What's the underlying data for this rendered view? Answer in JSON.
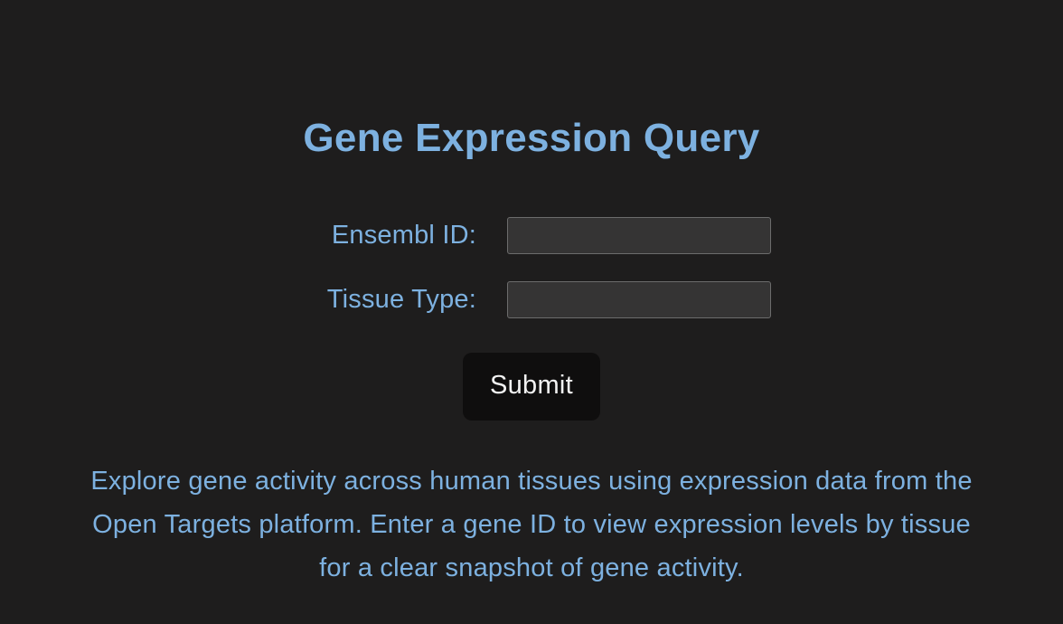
{
  "header": {
    "title": "Gene Expression Query"
  },
  "form": {
    "ensembl_id": {
      "label": "Ensembl ID:",
      "value": ""
    },
    "tissue_type": {
      "label": "Tissue Type:",
      "value": ""
    },
    "submit_label": "Submit"
  },
  "description": "Explore gene activity across human tissues using expression data from the Open Targets platform. Enter a gene ID to view expression levels by tissue for a clear snapshot of gene activity."
}
